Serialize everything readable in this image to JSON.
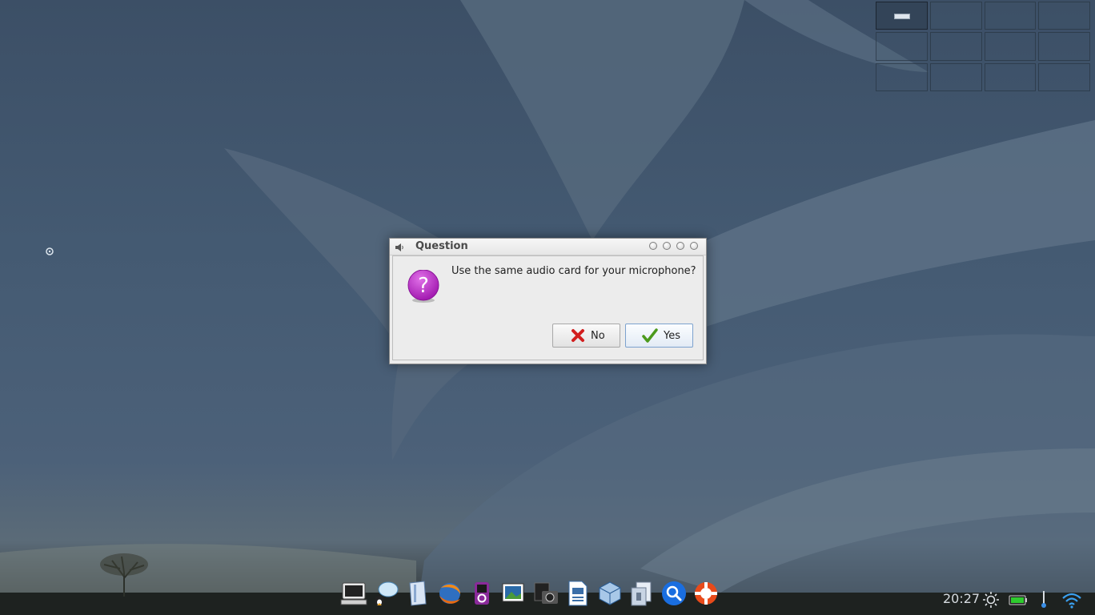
{
  "dialog": {
    "title": "Question",
    "message": "Use the same audio card for your microphone?",
    "buttons": {
      "no": "No",
      "yes": "Yes"
    }
  },
  "pager": {
    "workspaces": 12,
    "active_index": 0
  },
  "dock": {
    "apps": [
      "terminal-icon",
      "chat-icon",
      "files-icon",
      "browser-icon",
      "media-player-icon",
      "image-viewer-icon",
      "camera-icon",
      "writer-icon",
      "virtualbox-icon",
      "archive-icon",
      "search-icon",
      "help-icon"
    ]
  },
  "tray": {
    "clock": "20:27"
  },
  "colors": {
    "accent": "#7da2ce",
    "question_icon": "#c030c8"
  }
}
